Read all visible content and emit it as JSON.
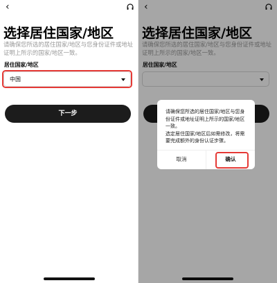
{
  "left_screen": {
    "back_icon": "‹",
    "support_icon_name": "headset-icon",
    "title": "选择居住国家/地区",
    "subtitle": "请确保您所选的居住国家/地区与您身份证件或地址证明上所示的国家/地区一致。",
    "field_label": "居住国家/地区",
    "selected_value": "中国",
    "button_label": "下一步"
  },
  "right_screen": {
    "back_icon": "‹",
    "support_icon_name": "headset-icon",
    "title": "选择居住国家/地区",
    "subtitle": "请确保您所选的居住国家/地区与您身份证件或地址证明上所示的国家/地区一致。",
    "field_label": "居住国家/地区",
    "dialog": {
      "line1": "请确保您所选的居住国家/地区与您身份证件或地址证明上所示的国家/地区一致。",
      "line2": "选定居住国家/地区后如需修改，将需要完成额外的身份认证步骤。",
      "cancel_label": "取消",
      "confirm_label": "确认"
    }
  },
  "colors": {
    "highlight": "#e53935",
    "primary_button": "#1c1c1c",
    "subtitle_text": "#9a9a9a"
  }
}
